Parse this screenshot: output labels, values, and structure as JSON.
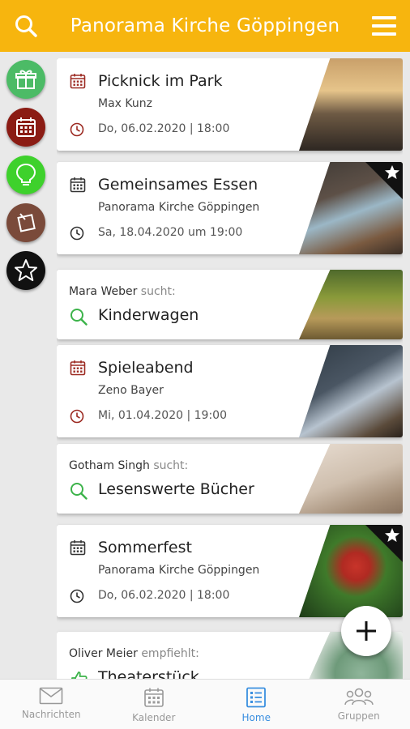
{
  "header": {
    "title": "Panorama Kirche Göppingen"
  },
  "sidebar": [
    {
      "name": "gift-icon",
      "color": "#4cbb66"
    },
    {
      "name": "calendar-icon",
      "color": "#8b1c14"
    },
    {
      "name": "lightbulb-icon",
      "color": "#3ed12c"
    },
    {
      "name": "note-icon",
      "color": "#7a4a3a"
    },
    {
      "name": "star-icon",
      "color": "#111111"
    }
  ],
  "cards": [
    {
      "type": "event",
      "title": "Picknick im Park",
      "organizer": "Max Kunz",
      "date": "Do, 06.02.2020 | 18:00",
      "icon_color": "#9c2a22",
      "featured": false
    },
    {
      "type": "event",
      "title": "Gemeinsames Essen",
      "organizer": "Panorama Kirche Göppingen",
      "date": "Sa, 18.04.2020 um 19:00",
      "icon_color": "#333333",
      "featured": true
    },
    {
      "type": "search",
      "person": "Mara Weber",
      "verb": "sucht:",
      "query": "Kinderwagen"
    },
    {
      "type": "event",
      "title": "Spieleabend",
      "organizer": "Zeno Bayer",
      "date": "Mi, 01.04.2020 | 19:00",
      "icon_color": "#9c2a22",
      "featured": false
    },
    {
      "type": "search",
      "person": "Gotham Singh",
      "verb": "sucht:",
      "query": "Lesenswerte Bücher"
    },
    {
      "type": "event",
      "title": "Sommerfest",
      "organizer": "Panorama Kirche Göppingen",
      "date": "Do, 06.02.2020 | 18:00",
      "icon_color": "#333333",
      "featured": true
    },
    {
      "type": "recommend",
      "person": "Oliver Meier",
      "verb": "empfiehlt:",
      "query": "Theaterstück"
    }
  ],
  "nav": [
    {
      "label": "Nachrichten",
      "icon": "mail-icon",
      "active": false
    },
    {
      "label": "Kalender",
      "icon": "calendar-icon",
      "active": false
    },
    {
      "label": "Home",
      "icon": "list-icon",
      "active": true
    },
    {
      "label": "Gruppen",
      "icon": "group-icon",
      "active": false
    }
  ],
  "colors": {
    "accent": "#f7b50e",
    "active_nav": "#3a8fe0",
    "search_green": "#3cb34a"
  }
}
